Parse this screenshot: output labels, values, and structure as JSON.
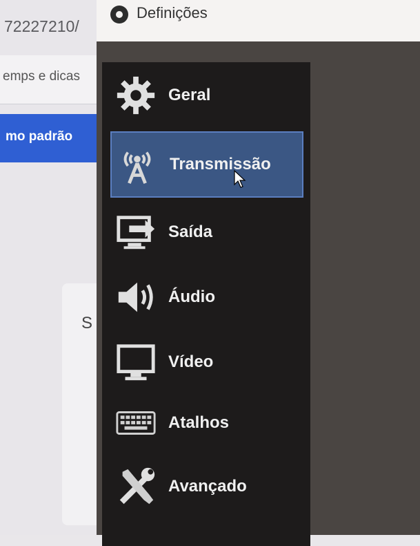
{
  "background": {
    "url_fragment": "72227210/",
    "tips_text": "emps e dicas",
    "default_button": "mo padrão",
    "panel_letter": "S"
  },
  "window": {
    "title": "Definições"
  },
  "sidebar": {
    "items": [
      {
        "label": "Geral",
        "icon": "gear-icon",
        "selected": false
      },
      {
        "label": "Transmissão",
        "icon": "broadcast-antenna-icon",
        "selected": true
      },
      {
        "label": "Saída",
        "icon": "output-monitor-icon",
        "selected": false
      },
      {
        "label": "Áudio",
        "icon": "speaker-icon",
        "selected": false
      },
      {
        "label": "Vídeo",
        "icon": "monitor-icon",
        "selected": false
      },
      {
        "label": "Atalhos",
        "icon": "keyboard-icon",
        "selected": false
      },
      {
        "label": "Avançado",
        "icon": "tools-icon",
        "selected": false
      }
    ]
  },
  "colors": {
    "selected_bg": "#3b5784",
    "sidebar_bg": "#1d1b1b",
    "accent_blue": "#2f5fd3"
  }
}
